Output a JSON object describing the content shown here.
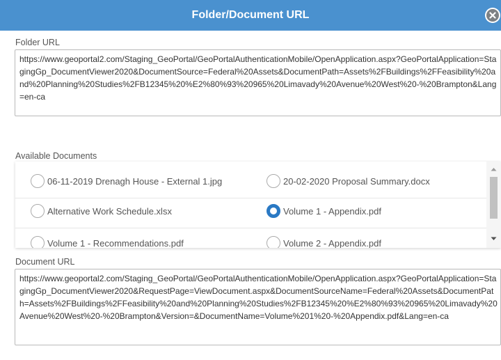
{
  "dialog": {
    "title": "Folder/Document URL",
    "close_icon": "close-circle-icon"
  },
  "folder_url": {
    "label": "Folder URL",
    "value": "https://www.geoportal2.com/Staging_GeoPortal/GeoPortalAuthenticationMobile/OpenApplication.aspx?GeoPortalApplication=StagingGp_DocumentViewer2020&DocumentSource=Federal%20Assets&DocumentPath=Assets%2FBuildings%2FFeasibility%20and%20Planning%20Studies%2FB12345%20%E2%80%93%20965%20Limavady%20Avenue%20West%20-%20Brampton&Lang=en-ca"
  },
  "available_documents": {
    "label": "Available Documents",
    "items": [
      {
        "name": "06-11-2019 Drenagh House - External 1.jpg",
        "selected": false
      },
      {
        "name": "20-02-2020 Proposal Summary.docx",
        "selected": false
      },
      {
        "name": "Alternative Work Schedule.xlsx",
        "selected": false
      },
      {
        "name": "Volume 1 - Appendix.pdf",
        "selected": true
      },
      {
        "name": "Volume 1 - Recommendations.pdf",
        "selected": false
      },
      {
        "name": "Volume 2 - Appendix.pdf",
        "selected": false
      }
    ]
  },
  "document_url": {
    "label": "Document URL",
    "value": "https://www.geoportal2.com/Staging_GeoPortal/GeoPortalAuthenticationMobile/OpenApplication.aspx?GeoPortalApplication=StagingGp_DocumentViewer2020&RequestPage=ViewDocument.aspx&DocumentSourceName=Federal%20Assets&DocumentPath=Assets%2FBuildings%2FFeasibility%20and%20Planning%20Studies%2FB12345%20%E2%80%93%20965%20Limavady%20Avenue%20West%20-%20Brampton&Version=&DocumentName=Volume%201%20-%20Appendix.pdf&Lang=en-ca"
  },
  "colors": {
    "titlebar": "#4a91cf",
    "radio_selected": "#2a79c4"
  }
}
